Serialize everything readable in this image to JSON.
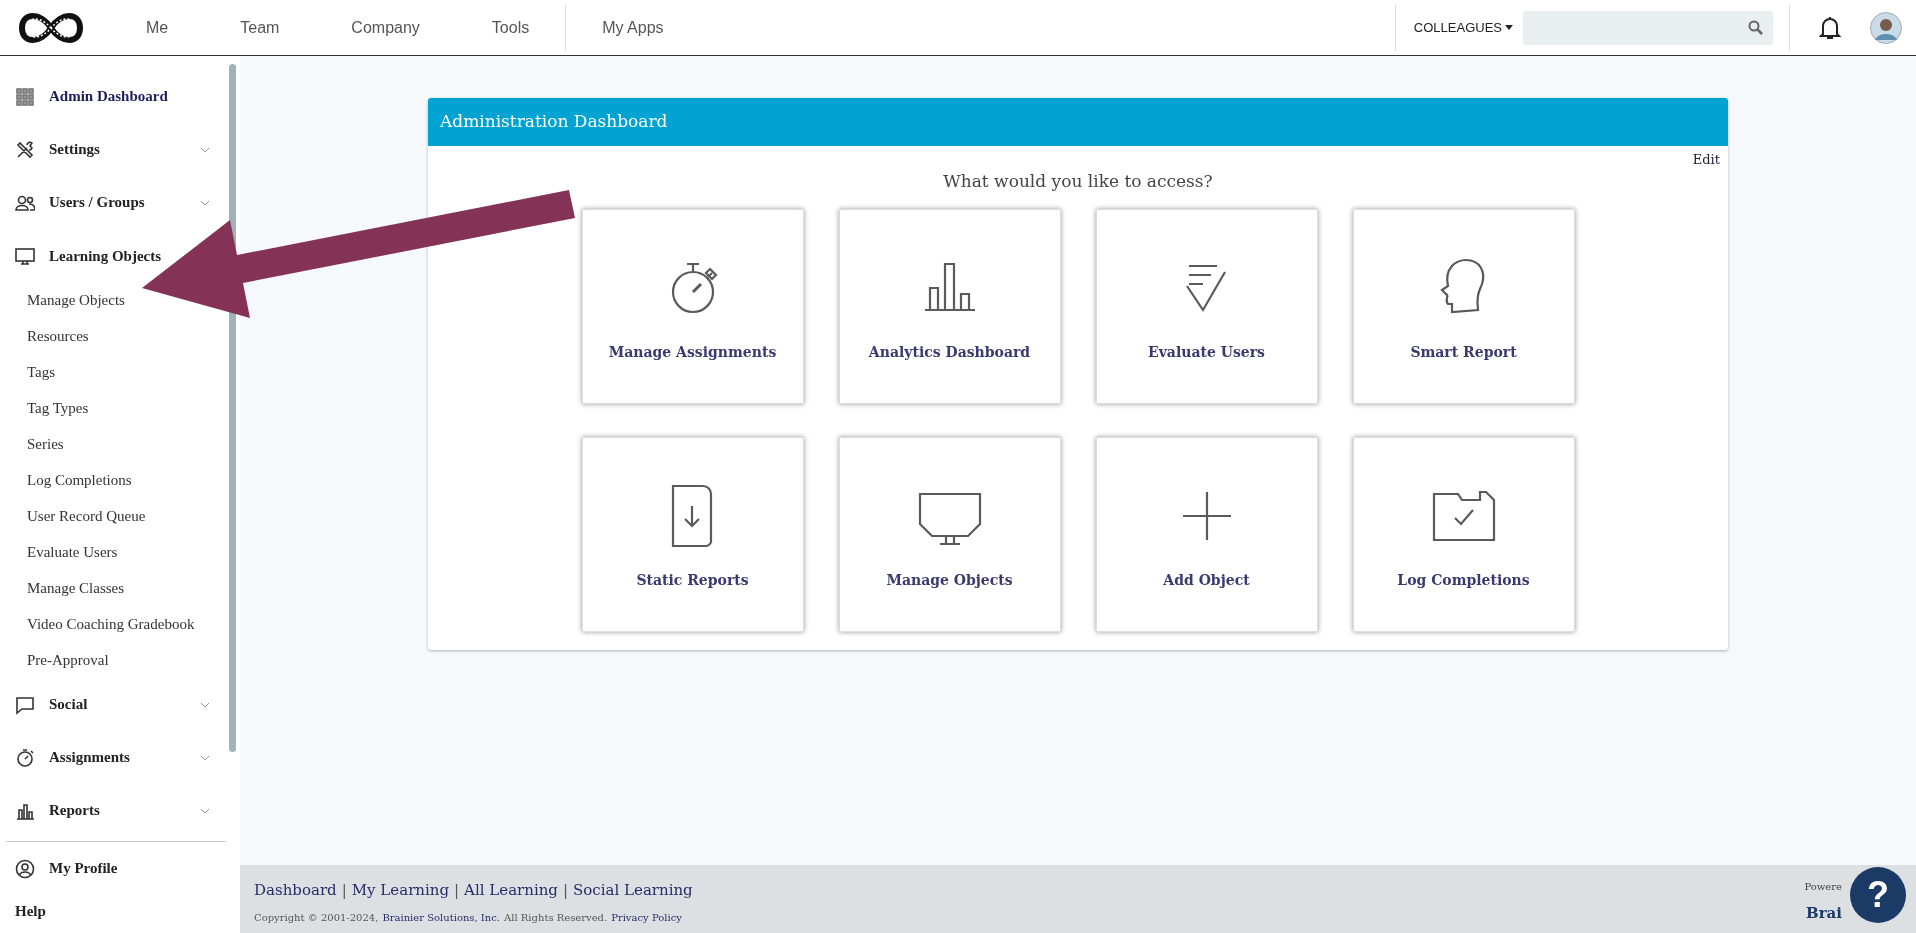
{
  "topnav": {
    "items": [
      {
        "label": "Me"
      },
      {
        "label": "Team"
      },
      {
        "label": "Company"
      },
      {
        "label": "Tools"
      },
      {
        "label": "My Apps"
      }
    ],
    "colleagues": "COLLEAGUES"
  },
  "sidebar": {
    "items": [
      {
        "label": "Admin Dashboard",
        "kind": "link",
        "selected": true
      },
      {
        "label": "Settings",
        "kind": "group",
        "expanded": false,
        "selected": false
      },
      {
        "label": "Users / Groups",
        "kind": "group",
        "expanded": false,
        "selected": false
      },
      {
        "label": "Learning Objects",
        "kind": "group",
        "expanded": true,
        "selected": false,
        "children": [
          {
            "label": "Manage Objects"
          },
          {
            "label": "Resources"
          },
          {
            "label": "Tags"
          },
          {
            "label": "Tag Types"
          },
          {
            "label": "Series"
          },
          {
            "label": "Log Completions"
          },
          {
            "label": "User Record Queue"
          },
          {
            "label": "Evaluate Users"
          },
          {
            "label": "Manage Classes"
          },
          {
            "label": "Video Coaching Gradebook"
          },
          {
            "label": "Pre-Approval"
          }
        ]
      },
      {
        "label": "Social",
        "kind": "group",
        "expanded": false,
        "selected": false
      },
      {
        "label": "Assignments",
        "kind": "group",
        "expanded": false,
        "selected": false
      },
      {
        "label": "Reports",
        "kind": "group",
        "expanded": false,
        "selected": false
      }
    ],
    "bottom_items": [
      {
        "label": "My Profile"
      },
      {
        "label": "Help"
      }
    ]
  },
  "panel": {
    "title": "Administration Dashboard",
    "edit": "Edit",
    "prompt": "What would you like to access?",
    "tiles": [
      {
        "label": "Manage Assignments"
      },
      {
        "label": "Analytics Dashboard"
      },
      {
        "label": "Evaluate Users"
      },
      {
        "label": "Smart Report"
      },
      {
        "label": "Static Reports"
      },
      {
        "label": "Manage Objects"
      },
      {
        "label": "Add Object"
      },
      {
        "label": "Log Completions"
      }
    ]
  },
  "footer": {
    "links": [
      "Dashboard",
      "My Learning",
      "All Learning",
      "Social Learning"
    ],
    "separators": [
      "|",
      "|",
      "|"
    ],
    "copyright": "Copyright © 2001-2024,",
    "company": "Brainier Solutions, Inc.",
    "rights": "All Rights Reserved.",
    "privacy": "Privacy Policy",
    "powered": "Powere",
    "brand": "Brai"
  },
  "help_button": "?"
}
